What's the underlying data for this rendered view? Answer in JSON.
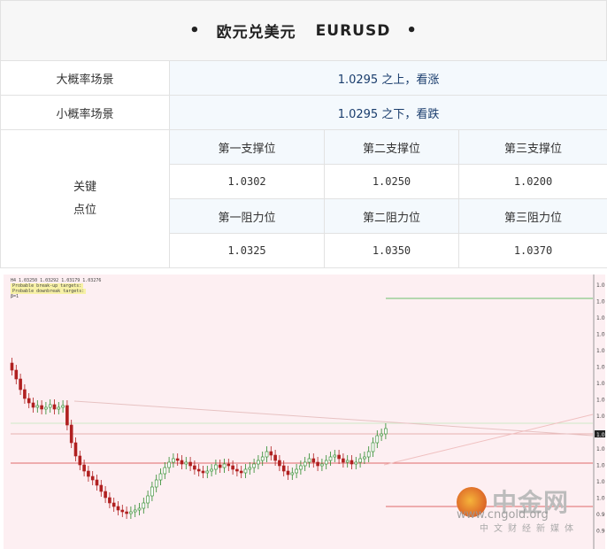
{
  "title": {
    "bullet": "•",
    "text_cn": "欧元兑美元",
    "text_en": "EURUSD"
  },
  "rows": {
    "big_label": "大概率场景",
    "big_value": "1.0295 之上，看涨",
    "small_label": "小概率场景",
    "small_value": "1.0295 之下，看跌",
    "key_label_1": "关键",
    "key_label_2": "点位"
  },
  "support": {
    "headers": [
      "第一支撑位",
      "第二支撑位",
      "第三支撑位"
    ],
    "values": [
      "1.0302",
      "1.0250",
      "1.0200"
    ]
  },
  "resistance": {
    "headers": [
      "第一阻力位",
      "第二阻力位",
      "第三阻力位"
    ],
    "values": [
      "1.0325",
      "1.0350",
      "1.0370"
    ]
  },
  "chart": {
    "hud_line1": "H4  1.03250 1.03292 1.03179 1.03276",
    "hud_line2": "Probable break-up targets:",
    "hud_line3": "Probable downbreak targets:",
    "hud_line4": "β=1",
    "price_tag": "1.0",
    "axis_labels": [
      "1.0",
      "1.0",
      "1.0",
      "1.0",
      "1.0",
      "1.0",
      "1.0",
      "1.0",
      "1.0",
      "1.0",
      "1.0",
      "1.0",
      "1.0",
      "1.0",
      "0.9",
      "0.9"
    ],
    "colors": {
      "up": "#2a8a2a",
      "down": "#b02020",
      "support_line": "#e06a6a",
      "resist_line": "#6cbf6c"
    }
  },
  "watermark": {
    "cn": "中金网",
    "sub": "中文财经新媒体",
    "url": "www.cngold.org"
  }
}
